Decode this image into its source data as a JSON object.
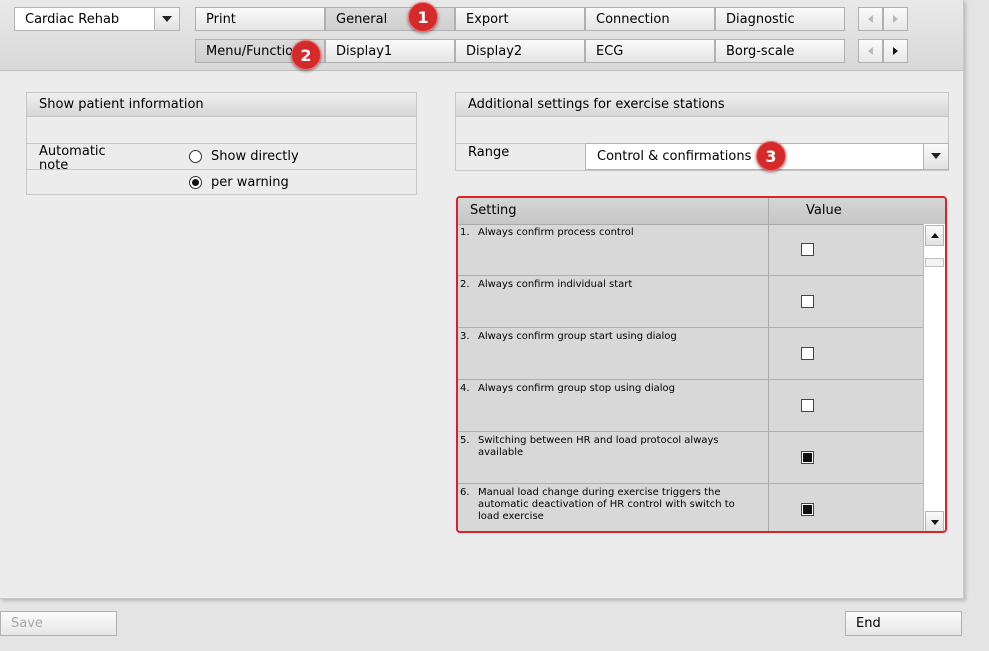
{
  "program_select": {
    "value": "Cardiac Rehab"
  },
  "tabs_row1": [
    {
      "label": "Print"
    },
    {
      "label": "General"
    },
    {
      "label": "Export"
    },
    {
      "label": "Connection"
    },
    {
      "label": "Diagnostic"
    }
  ],
  "tabs_row2": [
    {
      "label": "Menu/Functions"
    },
    {
      "label": "Display1"
    },
    {
      "label": "Display2"
    },
    {
      "label": "ECG"
    },
    {
      "label": "Borg-scale"
    }
  ],
  "callouts": [
    "1",
    "2",
    "3"
  ],
  "patient_panel": {
    "title": "Show patient information",
    "field_label": "Automatic note",
    "options": [
      {
        "label": "Show directly",
        "selected": false
      },
      {
        "label": "per warning",
        "selected": true
      }
    ]
  },
  "stations_panel": {
    "title": "Additional settings for exercise stations",
    "range_label": "Range",
    "range_value": "Control & confirmations"
  },
  "settings_table": {
    "columns": [
      "Setting",
      "Value"
    ],
    "rows": [
      {
        "num": "1.",
        "text": "Always confirm process control",
        "checked": false
      },
      {
        "num": "2.",
        "text": "Always confirm individual start",
        "checked": false
      },
      {
        "num": "3.",
        "text": "Always confirm group start using dialog",
        "checked": false
      },
      {
        "num": "4.",
        "text": "Always confirm group stop using dialog",
        "checked": false
      },
      {
        "num": "5.",
        "text": "Switching between HR and load protocol always available",
        "checked": true
      },
      {
        "num": "6.",
        "text": "Manual load change during exercise triggers the automatic deactivation of HR control with switch to load exercise",
        "checked": true
      }
    ]
  },
  "footer": {
    "save_label": "Save",
    "end_label": "End"
  },
  "colors": {
    "highlight": "#d9232c",
    "badge": "#d42a2a"
  }
}
